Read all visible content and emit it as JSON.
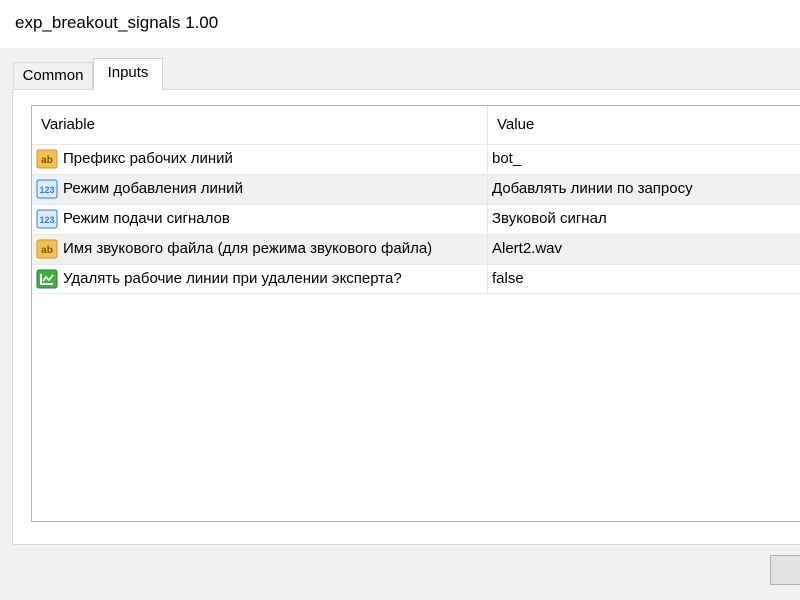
{
  "window": {
    "title": "exp_breakout_signals 1.00"
  },
  "tabs": [
    {
      "label": "Common",
      "active": false
    },
    {
      "label": "Inputs",
      "active": true
    }
  ],
  "grid": {
    "headers": {
      "variable": "Variable",
      "value": "Value"
    },
    "rows": [
      {
        "type": "string-icon",
        "icon_text": "ab",
        "variable": "Префикс рабочих линий",
        "value": "bot_"
      },
      {
        "type": "enum-icon",
        "icon_text": "123",
        "variable": "Режим добавления линий",
        "value": "Добавлять линии по запросу"
      },
      {
        "type": "enum-icon",
        "icon_text": "123",
        "variable": "Режим подачи сигналов",
        "value": "Звуковой сигнал"
      },
      {
        "type": "string-icon",
        "icon_text": "ab",
        "variable": "Имя звукового файла (для режима звукового файла)",
        "value": "Alert2.wav"
      },
      {
        "type": "bool-icon",
        "icon_text": "",
        "variable": "Удалять рабочие линии при удалении эксперта?",
        "value": "false"
      }
    ]
  },
  "colors": {
    "string_icon": "#f2c14e",
    "enum_icon": "#2f7fd6",
    "bool_icon": "#3cb043",
    "row_alt": "#f0f0f0"
  }
}
